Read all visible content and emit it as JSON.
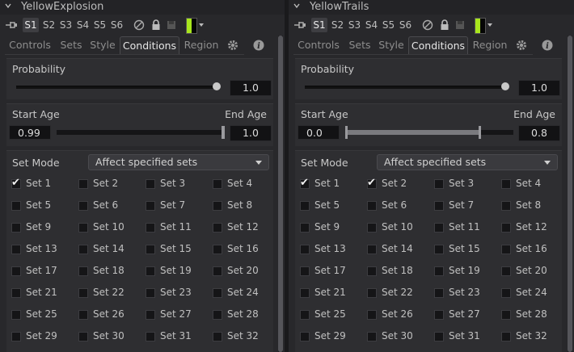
{
  "panels": [
    {
      "id": "left",
      "title": "YellowExplosion",
      "set_buttons": [
        "S1",
        "S2",
        "S3",
        "S4",
        "S5",
        "S6"
      ],
      "active_set": "S1",
      "swatch_color": "#a8e61d",
      "tabs": [
        {
          "label": "Controls"
        },
        {
          "label": "Sets"
        },
        {
          "label": "Style"
        },
        {
          "label": "Conditions",
          "active": true
        },
        {
          "label": "Region"
        }
      ],
      "probability": {
        "label": "Probability",
        "value": "1.0",
        "fraction": 1.0
      },
      "age": {
        "start_label": "Start Age",
        "end_label": "End Age",
        "start": "0.99",
        "end": "1.0",
        "start_frac": 0.99,
        "end_frac": 1.0
      },
      "set_mode": {
        "label": "Set Mode",
        "value": "Affect specified sets"
      },
      "sets": [
        "Set 1",
        "Set 2",
        "Set 3",
        "Set 4",
        "Set 5",
        "Set 6",
        "Set 7",
        "Set 8",
        "Set 9",
        "Set 10",
        "Set 11",
        "Set 12",
        "Set 13",
        "Set 14",
        "Set 15",
        "Set 16",
        "Set 17",
        "Set 18",
        "Set 19",
        "Set 20",
        "Set 21",
        "Set 22",
        "Set 23",
        "Set 24",
        "Set 25",
        "Set 26",
        "Set 27",
        "Set 28",
        "Set 29",
        "Set 30",
        "Set 31",
        "Set 32"
      ],
      "checked": [
        1
      ]
    },
    {
      "id": "right",
      "title": "YellowTrails",
      "set_buttons": [
        "S1",
        "S2",
        "S3",
        "S4",
        "S5",
        "S6"
      ],
      "active_set": "S1",
      "swatch_color": "#a8e61d",
      "tabs": [
        {
          "label": "Controls"
        },
        {
          "label": "Sets"
        },
        {
          "label": "Style"
        },
        {
          "label": "Conditions",
          "active": true
        },
        {
          "label": "Region"
        }
      ],
      "probability": {
        "label": "Probability",
        "value": "1.0",
        "fraction": 1.0
      },
      "age": {
        "start_label": "Start Age",
        "end_label": "End Age",
        "start": "0.0",
        "end": "0.8",
        "start_frac": 0.0,
        "end_frac": 0.8
      },
      "set_mode": {
        "label": "Set Mode",
        "value": "Affect specified sets"
      },
      "sets": [
        "Set 1",
        "Set 2",
        "Set 3",
        "Set 4",
        "Set 5",
        "Set 6",
        "Set 7",
        "Set 8",
        "Set 9",
        "Set 10",
        "Set 11",
        "Set 12",
        "Set 13",
        "Set 14",
        "Set 15",
        "Set 16",
        "Set 17",
        "Set 18",
        "Set 19",
        "Set 20",
        "Set 21",
        "Set 22",
        "Set 23",
        "Set 24",
        "Set 25",
        "Set 26",
        "Set 27",
        "Set 28",
        "Set 29",
        "Set 30",
        "Set 31",
        "Set 32"
      ],
      "checked": [
        1,
        2
      ]
    }
  ],
  "icons": {
    "collapse": "chevron-down-icon",
    "pin": "pin-icon",
    "disable": "disable-icon",
    "lock": "lock-icon",
    "save": "save-icon",
    "settings": "gear-icon",
    "info": "info-icon"
  }
}
